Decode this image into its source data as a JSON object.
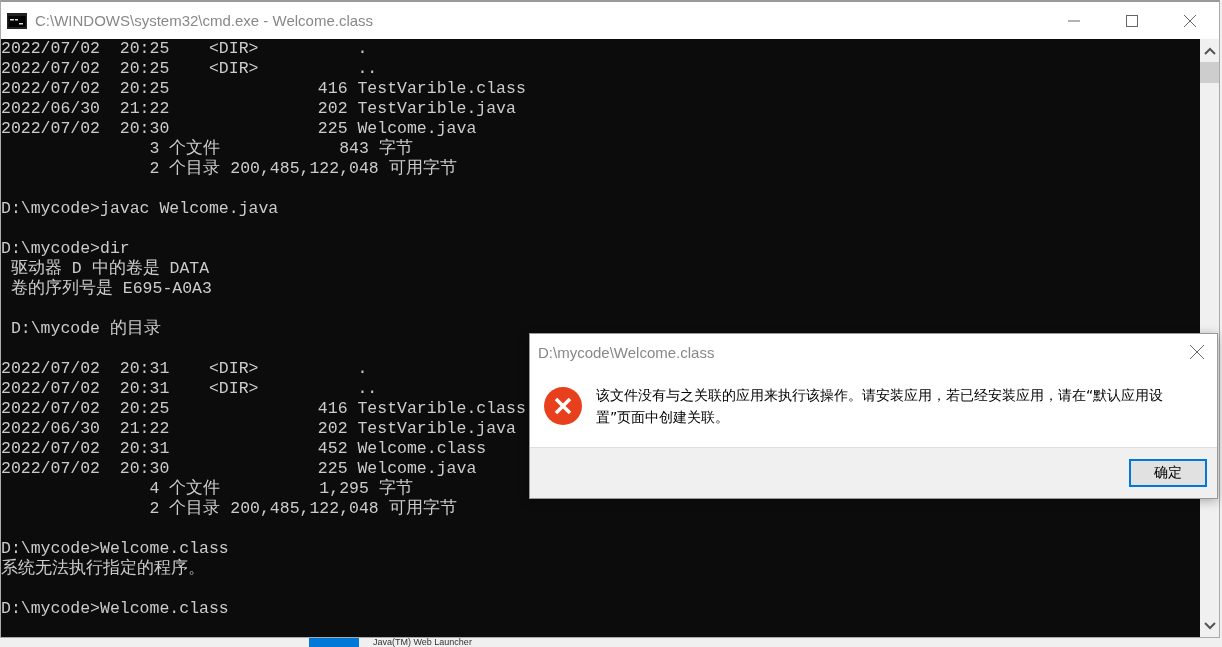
{
  "window": {
    "title": "C:\\WINDOWS\\system32\\cmd.exe - Welcome.class"
  },
  "console": {
    "blocks": [
      [
        "2022/07/02  20:25    <DIR>          .",
        "2022/07/02  20:25    <DIR>          ..",
        "2022/07/02  20:25               416 TestVarible.class",
        "2022/06/30  21:22               202 TestVarible.java",
        "2022/07/02  20:30               225 Welcome.java",
        "               3 个文件            843 字节",
        "               2 个目录 200,485,122,048 可用字节"
      ],
      [
        "D:\\mycode>javac Welcome.java"
      ],
      [
        "D:\\mycode>dir",
        " 驱动器 D 中的卷是 DATA",
        " 卷的序列号是 E695-A0A3"
      ],
      [
        " D:\\mycode 的目录"
      ],
      [
        "2022/07/02  20:31    <DIR>          .",
        "2022/07/02  20:31    <DIR>          ..",
        "2022/07/02  20:25               416 TestVarible.class",
        "2022/06/30  21:22               202 TestVarible.java",
        "2022/07/02  20:31               452 Welcome.class",
        "2022/07/02  20:30               225 Welcome.java",
        "               4 个文件          1,295 字节",
        "               2 个目录 200,485,122,048 可用字节"
      ],
      [
        "D:\\mycode>Welcome.class",
        "系统无法执行指定的程序。"
      ],
      [
        "D:\\mycode>Welcome.class"
      ]
    ]
  },
  "dialog": {
    "title": "D:\\mycode\\Welcome.class",
    "message": "该文件没有与之关联的应用来执行该操作。请安装应用，若已经安装应用，请在“默认应用设置”页面中创建关联。",
    "button": "确定"
  },
  "taskbar_item": {
    "label": "Java(TM) Web Launcher"
  }
}
